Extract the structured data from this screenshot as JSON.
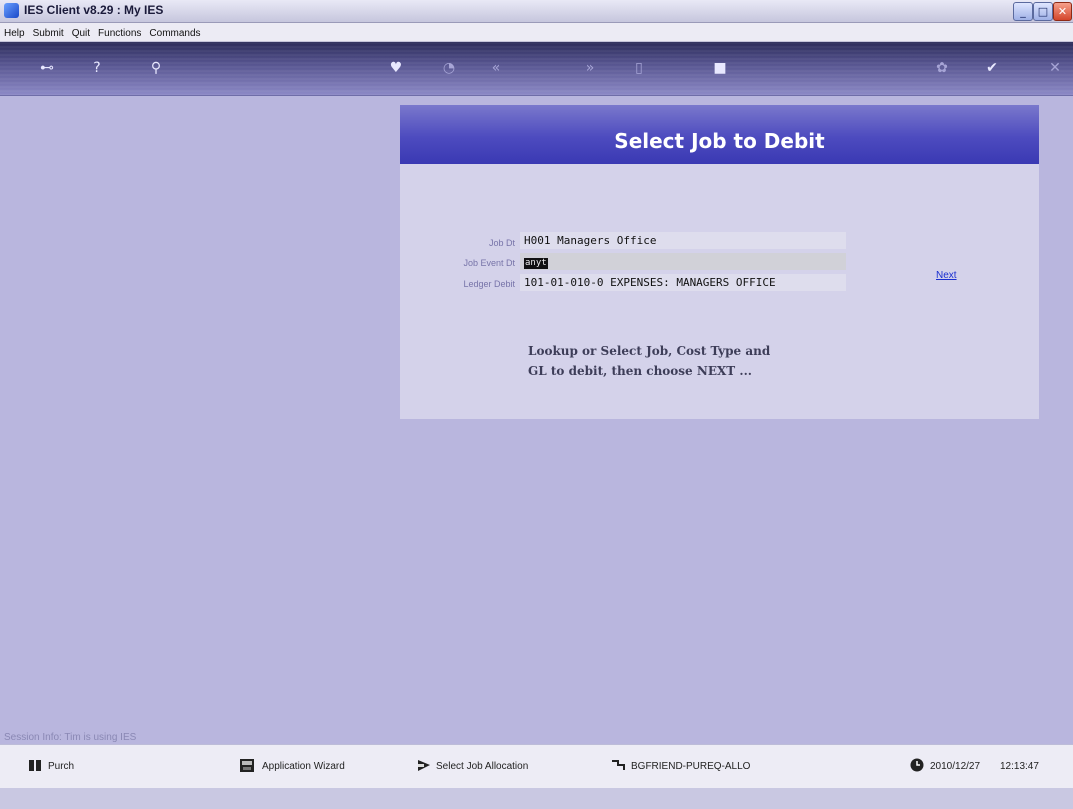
{
  "window": {
    "title": "IES Client v8.29 : My IES"
  },
  "menu": [
    "Help",
    "Submit",
    "Quit",
    "Functions",
    "Commands"
  ],
  "toolbar": {
    "icons": [
      "key-icon",
      "help-icon",
      "search-icon",
      "heart-icon",
      "clock-icon",
      "back-icon",
      "forward-icon",
      "page-icon",
      "stop-icon",
      "settings-icon",
      "ok-icon",
      "cancel-icon"
    ]
  },
  "form": {
    "title": "Select Job to Debit",
    "job_label": "Job Dt",
    "job_value": "H001 Managers Office",
    "event_label": "Job Event Dt",
    "event_value": "anyt",
    "ledger_label": "Ledger Debit",
    "ledger_value": "101-01-010-0 EXPENSES: MANAGERS OFFICE",
    "next_label": "Next",
    "hint_line1": "Lookup or Select Job, Cost Type and",
    "hint_line2": "GL to debit, then choose NEXT ..."
  },
  "session": {
    "info": "Session Info: Tim is using IES"
  },
  "statusbar": {
    "purch": "Purch",
    "wizard": "Application Wizard",
    "select_job": "Select Job Allocation",
    "code": "BGFRIEND-PUREQ-ALLO",
    "date": "2010/12/27",
    "time": "12:13:47"
  }
}
